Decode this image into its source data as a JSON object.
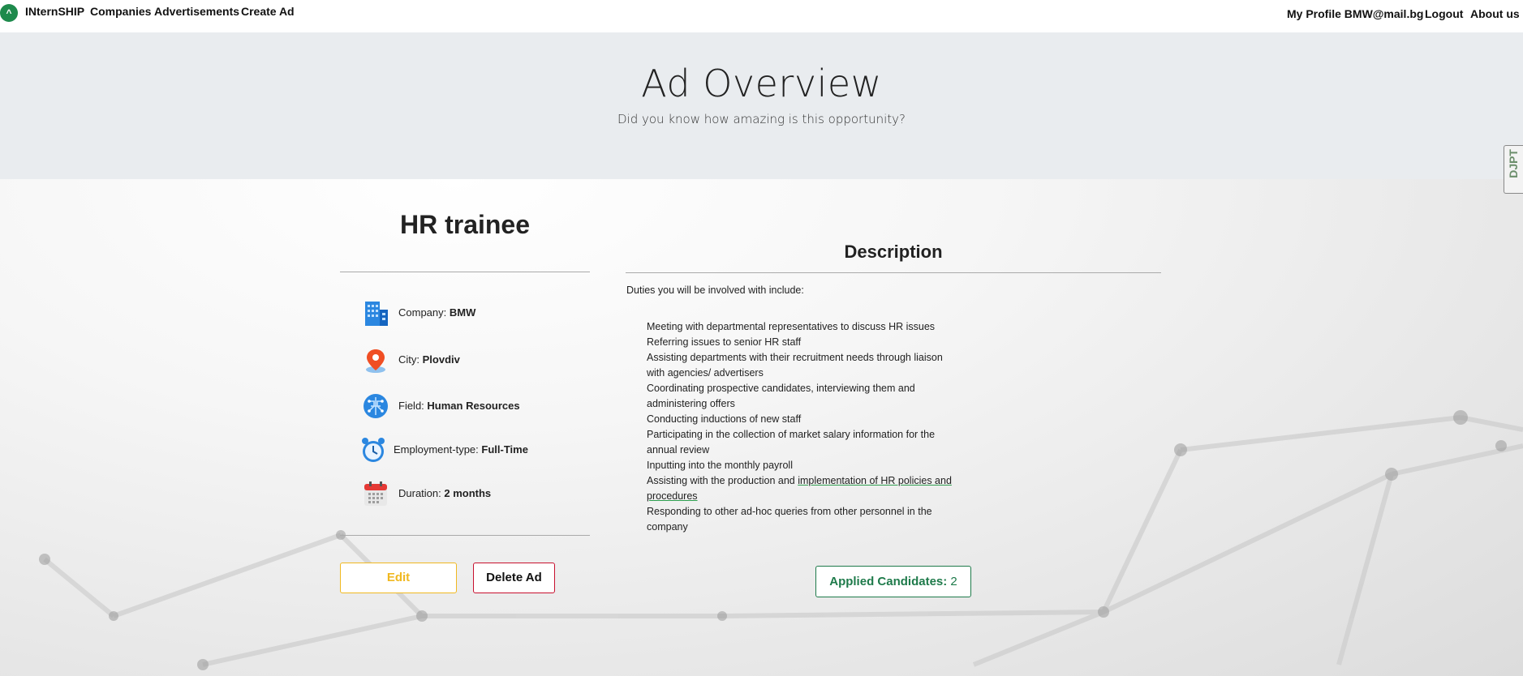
{
  "navbar": {
    "brand": "INternSHIP",
    "links": [
      "Companies",
      "Advertisements",
      "Create Ad"
    ],
    "right_links": [
      "My Profile BMW@mail.bg",
      "Logout",
      "About us"
    ]
  },
  "hero": {
    "title": "Ad Overview",
    "subtitle": "Did you know how amazing is this opportunity?"
  },
  "side_tab": {
    "label": "DJPT"
  },
  "ad": {
    "title": "HR trainee",
    "company_label": "Company:",
    "company": "BMW",
    "city_label": "City:",
    "city": "Plovdiv",
    "field_label": "Field:",
    "field": "Human Resources",
    "employment_label": "Employment-type:",
    "employment": "Full-Time",
    "duration_label": "Duration:",
    "duration": "2 months"
  },
  "description": {
    "title": "Description",
    "intro": "Duties you will be involved with include:",
    "items": [
      "Meeting with departmental representatives to discuss HR issues",
      "Referring issues to senior HR staff",
      "Assisting departments with their recruitment needs through liaison with agencies/ advertisers",
      "Coordinating prospective candidates, interviewing them and administering offers",
      "Conducting inductions of new staff",
      "Participating in the collection of market salary information for the annual review",
      "Inputting into the monthly payroll",
      "Assisting with the production and ",
      "Responding to other ad-hoc queries from other personnel in the company"
    ],
    "item_underlined_part": "implementation of HR policies and procedures"
  },
  "buttons": {
    "edit": "Edit",
    "delete": "Delete Ad",
    "applied_label": "Applied Candidates:",
    "applied_count": "2"
  },
  "colors": {
    "brand_green": "#1e8a4c",
    "edit_yellow": "#f0b820",
    "delete_red": "#c8102e",
    "applied_green": "#1e7a4a"
  }
}
